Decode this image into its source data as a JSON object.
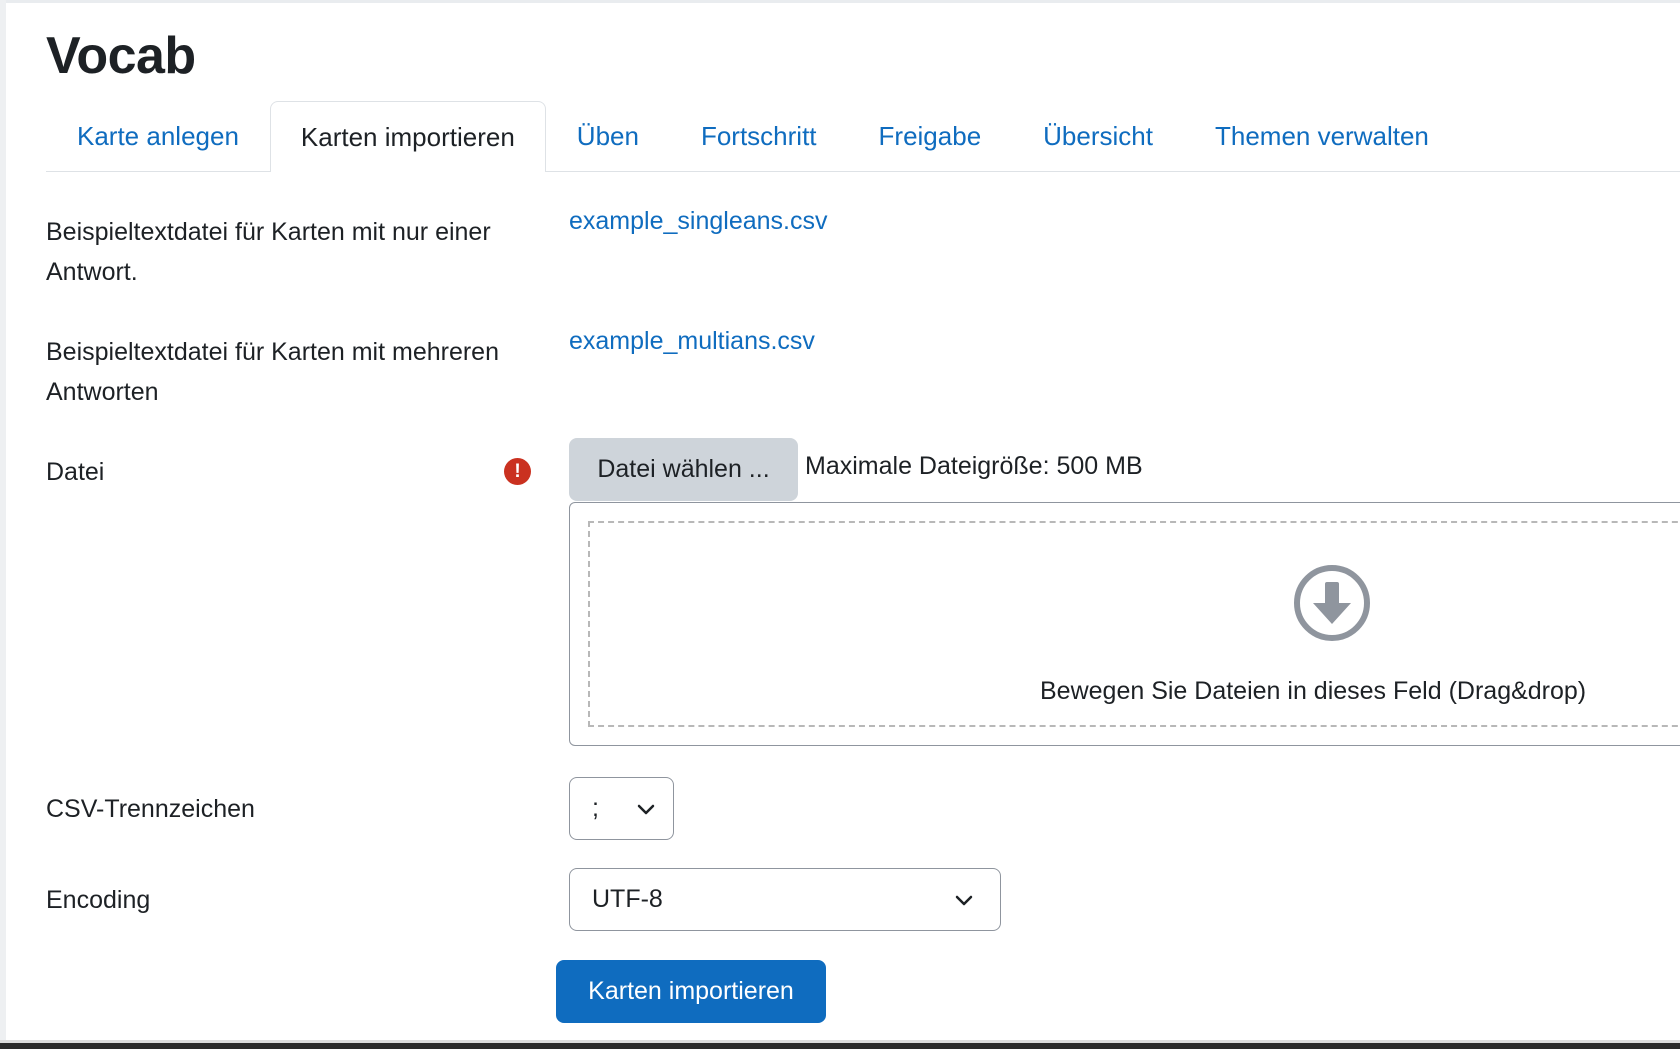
{
  "page": {
    "title": "Vocab"
  },
  "tabs": [
    {
      "label": "Karte anlegen"
    },
    {
      "label": "Karten importieren",
      "active": true
    },
    {
      "label": "Üben"
    },
    {
      "label": "Fortschritt"
    },
    {
      "label": "Freigabe"
    },
    {
      "label": "Übersicht"
    },
    {
      "label": "Themen verwalten"
    }
  ],
  "form": {
    "single_example": {
      "label": "Beispieltextdatei für Karten mit nur einer Antwort.",
      "link": "example_singleans.csv"
    },
    "multi_example": {
      "label": "Beispieltextdatei für Karten mit mehreren Antworten",
      "link": "example_multians.csv"
    },
    "file": {
      "label": "Datei",
      "required_icon": "exclamation-circle-icon",
      "required_symbol": "!",
      "choose_button": "Datei wählen ...",
      "max_size": "Maximale Dateigröße: 500 MB",
      "drop_icon": "download-arrow-circle-icon",
      "drop_text": "Bewegen Sie Dateien in dieses Feld (Drag&drop)"
    },
    "delimiter": {
      "label": "CSV-Trennzeichen",
      "value": ";"
    },
    "encoding": {
      "label": "Encoding",
      "value": "UTF-8"
    },
    "submit": {
      "label": "Karten importieren"
    }
  },
  "colors": {
    "link": "#0f6cbf",
    "primary_button": "#0f6cbf",
    "secondary_button": "#ced4da",
    "required": "#ca3120"
  }
}
